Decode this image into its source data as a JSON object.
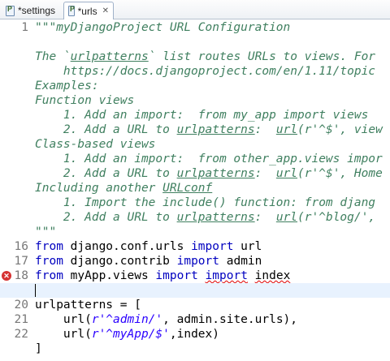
{
  "tabs": [
    {
      "label": "*settings",
      "active": false
    },
    {
      "label": "*urls",
      "active": true,
      "close_icon": "close-icon"
    }
  ],
  "lines": [
    {
      "num": "1",
      "segs": [
        {
          "t": "\"\"\"myDjangoProject URL Configuration",
          "c": "doc"
        }
      ]
    },
    {
      "num": "",
      "segs": []
    },
    {
      "num": "",
      "segs": [
        {
          "t": "The `",
          "c": "doc"
        },
        {
          "t": "urlpatterns",
          "c": "doc-u"
        },
        {
          "t": "` list routes URLs to views. For",
          "c": "doc"
        }
      ]
    },
    {
      "num": "",
      "segs": [
        {
          "t": "    https://docs.djangoproject.com/en/1.11/topic",
          "c": "doc"
        }
      ]
    },
    {
      "num": "",
      "segs": [
        {
          "t": "Examples:",
          "c": "doc"
        }
      ]
    },
    {
      "num": "",
      "segs": [
        {
          "t": "Function views",
          "c": "doc"
        }
      ]
    },
    {
      "num": "",
      "segs": [
        {
          "t": "    1. Add an import:  from my_app import views",
          "c": "doc"
        }
      ]
    },
    {
      "num": "",
      "segs": [
        {
          "t": "    2. Add a URL to ",
          "c": "doc"
        },
        {
          "t": "urlpatterns",
          "c": "doc-u"
        },
        {
          "t": ":  ",
          "c": "doc"
        },
        {
          "t": "url",
          "c": "doc-u"
        },
        {
          "t": "(r'^$', view",
          "c": "doc"
        }
      ]
    },
    {
      "num": "",
      "segs": [
        {
          "t": "Class-based views",
          "c": "doc"
        }
      ]
    },
    {
      "num": "",
      "segs": [
        {
          "t": "    1. Add an import:  from other_app.views impor",
          "c": "doc"
        }
      ]
    },
    {
      "num": "",
      "segs": [
        {
          "t": "    2. Add a URL to ",
          "c": "doc"
        },
        {
          "t": "urlpatterns",
          "c": "doc-u"
        },
        {
          "t": ":  ",
          "c": "doc"
        },
        {
          "t": "url",
          "c": "doc-u"
        },
        {
          "t": "(r'^$', Home",
          "c": "doc"
        }
      ]
    },
    {
      "num": "",
      "segs": [
        {
          "t": "Including another ",
          "c": "doc"
        },
        {
          "t": "URLconf",
          "c": "doc-u"
        }
      ]
    },
    {
      "num": "",
      "segs": [
        {
          "t": "    1. Import the include() function: from djang",
          "c": "doc"
        }
      ]
    },
    {
      "num": "",
      "segs": [
        {
          "t": "    2. Add a URL to ",
          "c": "doc"
        },
        {
          "t": "urlpatterns",
          "c": "doc-u"
        },
        {
          "t": ":  ",
          "c": "doc"
        },
        {
          "t": "url",
          "c": "doc-u"
        },
        {
          "t": "(r'^blog/',",
          "c": "doc"
        }
      ]
    },
    {
      "num": "",
      "segs": [
        {
          "t": "\"\"\"",
          "c": "doc"
        }
      ]
    },
    {
      "num": "16",
      "segs": [
        {
          "t": "from",
          "c": "kw"
        },
        {
          "t": " django.conf.urls ",
          "c": ""
        },
        {
          "t": "import",
          "c": "kw"
        },
        {
          "t": " url",
          "c": ""
        }
      ]
    },
    {
      "num": "17",
      "segs": [
        {
          "t": "from",
          "c": "kw"
        },
        {
          "t": " django.contrib ",
          "c": ""
        },
        {
          "t": "import",
          "c": "kw"
        },
        {
          "t": " admin",
          "c": ""
        }
      ]
    },
    {
      "num": "18",
      "error": true,
      "segs": [
        {
          "t": "from",
          "c": "kw"
        },
        {
          "t": " myApp.views ",
          "c": ""
        },
        {
          "t": "import",
          "c": "kw"
        },
        {
          "t": " ",
          "c": ""
        },
        {
          "t": "import",
          "c": "kw-err"
        },
        {
          "t": " ",
          "c": ""
        },
        {
          "t": "index",
          "c": "err"
        }
      ]
    },
    {
      "num": "",
      "cursor": true,
      "segs": []
    },
    {
      "num": "20",
      "segs": [
        {
          "t": "urlpatterns = [",
          "c": ""
        }
      ]
    },
    {
      "num": "21",
      "segs": [
        {
          "t": "    url(",
          "c": ""
        },
        {
          "t": "r'^admin/'",
          "c": "str"
        },
        {
          "t": ", admin.site.urls),",
          "c": ""
        }
      ]
    },
    {
      "num": "22",
      "segs": [
        {
          "t": "    url(",
          "c": ""
        },
        {
          "t": "r'^myApp/$'",
          "c": "str"
        },
        {
          "t": ",index)",
          "c": ""
        }
      ]
    },
    {
      "num": "",
      "segs": [
        {
          "t": "]",
          "c": ""
        }
      ]
    }
  ]
}
